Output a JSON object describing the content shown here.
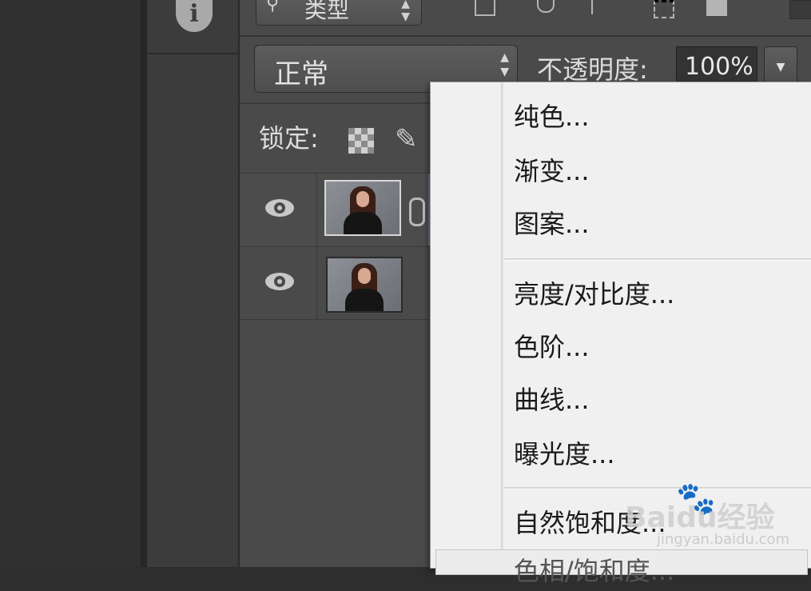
{
  "filter": {
    "label": "类型"
  },
  "blend": {
    "mode": "正常",
    "opacity_label": "不透明度:",
    "opacity_value": "100%"
  },
  "lock": {
    "label": "锁定:"
  },
  "menu": {
    "items": [
      "纯色...",
      "渐变...",
      "图案...",
      "亮度/对比度...",
      "色阶...",
      "曲线...",
      "曝光度...",
      "自然饱和度...",
      "色相/饱和度..."
    ]
  },
  "watermark": {
    "brand": "Baidu经验",
    "url": "jingyan.baidu.com"
  },
  "colors": {
    "panel_bg": "#4a4a4a",
    "menu_bg": "#f0f0f0",
    "selection": "#6a7388"
  }
}
